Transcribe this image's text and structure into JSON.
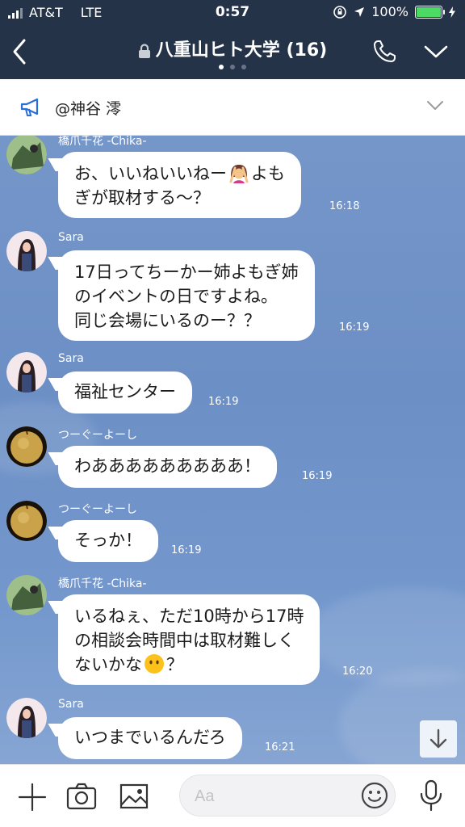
{
  "status": {
    "carrier": "AT&T",
    "network": "LTE",
    "time": "0:57",
    "battery": "100%"
  },
  "header": {
    "title": "八重山ヒト大学 (16)"
  },
  "notice": {
    "text": "@神谷 澪"
  },
  "messages": [
    {
      "name": "橋爪千花 -Chika-",
      "lines": [
        "お、いいねいいねー",
        "ぎが取材する～？"
      ],
      "line1_suffix": "よも",
      "time": "16:18"
    },
    {
      "name": "Sara",
      "lines": [
        "17日ってちーかー姉よもぎ姉",
        "のイベントの日ですよね。",
        "同じ会場にいるのー？？"
      ],
      "time": "16:19"
    },
    {
      "name": "Sara",
      "lines": [
        "福祉センター"
      ],
      "time": "16:19"
    },
    {
      "name": "つーぐーよーし",
      "lines": [
        "わあああああああああ！"
      ],
      "time": "16:19"
    },
    {
      "name": "つーぐーよーし",
      "lines": [
        "そっか！"
      ],
      "time": "16:19"
    },
    {
      "name": "橋爪千花 -Chika-",
      "lines": [
        "いるねぇ、ただ10時から17時",
        "の相談会時間中は取材難しく",
        "ないかな"
      ],
      "line3_suffix": "？",
      "time": "16:20"
    },
    {
      "name": "Sara",
      "lines": [
        "いつまでいるんだろ"
      ],
      "time": "16:21"
    }
  ],
  "input": {
    "placeholder": "Aa"
  },
  "colors": {
    "header_bg": "#253349",
    "chat_bg": "#6f90c4",
    "bubble": "#ffffff",
    "battery": "#4cd964",
    "accent_icon": "#1a73e8"
  },
  "icons": [
    "signal-icon",
    "lock-icon",
    "phone-icon",
    "chevron-down-icon",
    "back-icon",
    "megaphone-icon",
    "plus-icon",
    "camera-icon",
    "image-icon",
    "smile-icon",
    "mic-icon",
    "arrow-down-icon"
  ]
}
